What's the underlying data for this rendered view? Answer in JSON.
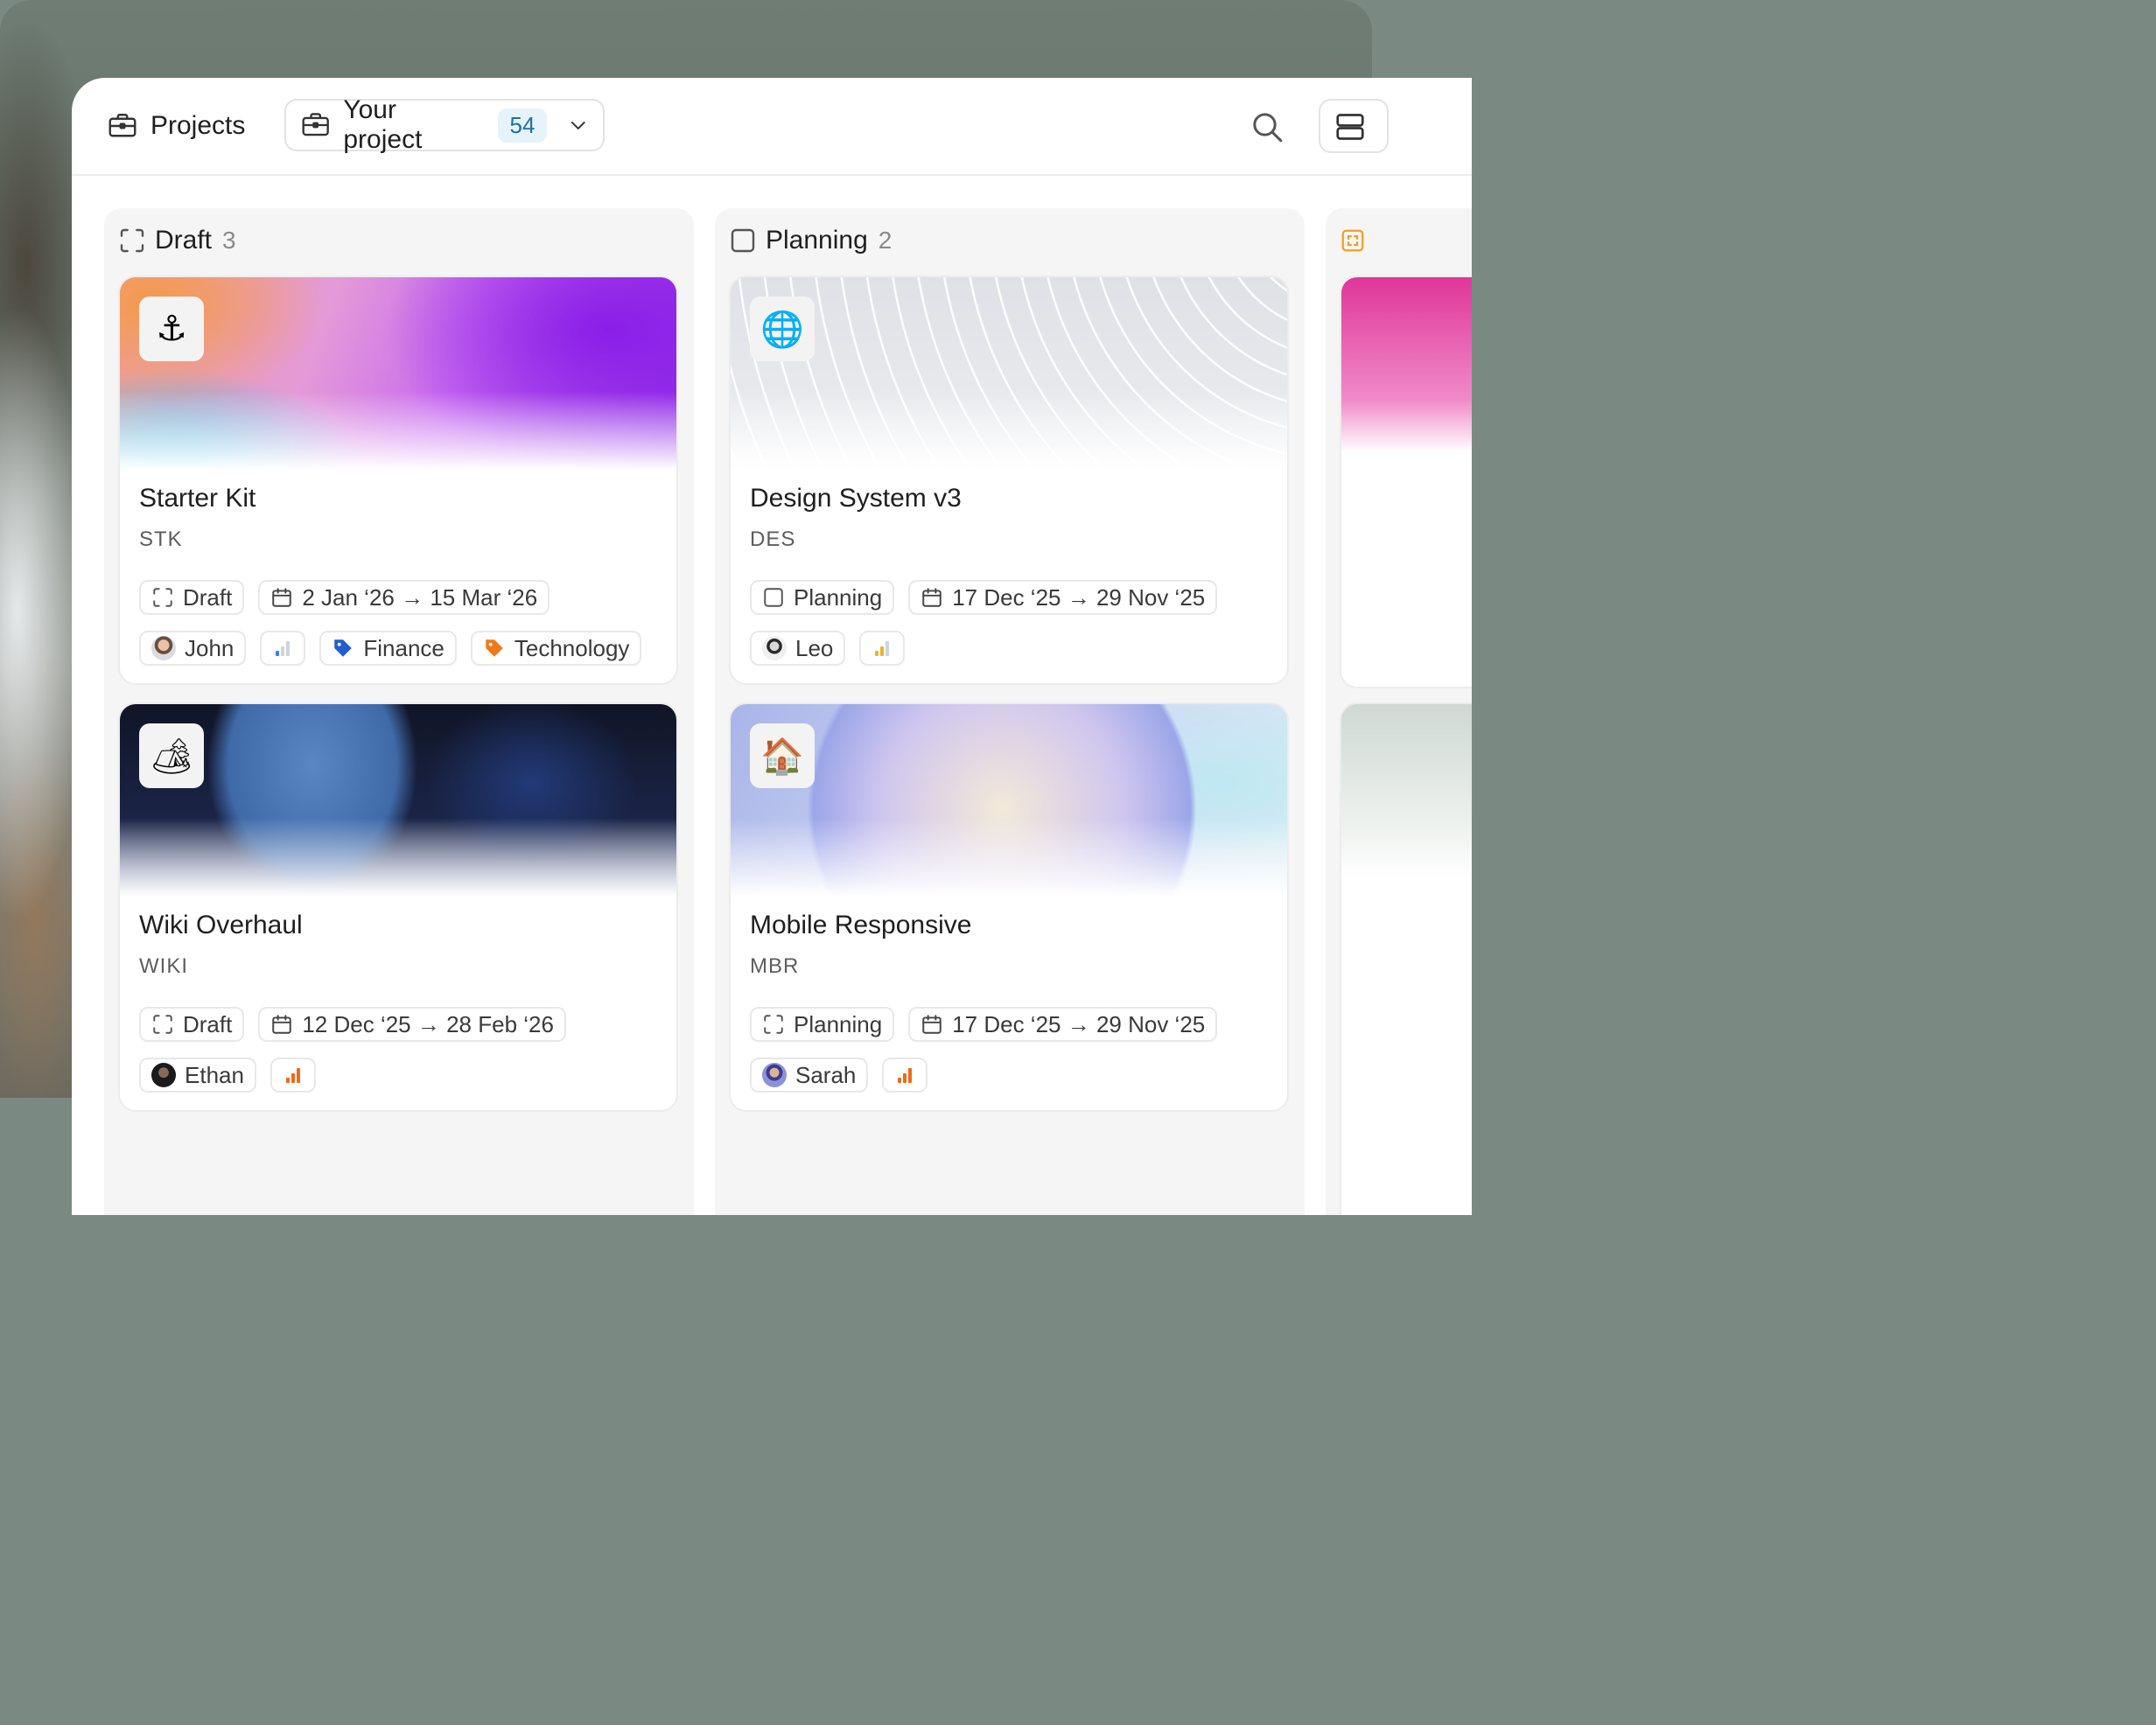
{
  "header": {
    "breadcrumb_label": "Projects",
    "project_selector": {
      "label": "Your project",
      "count": "54"
    }
  },
  "columns": [
    {
      "title": "Draft",
      "count": "3",
      "cards": [
        {
          "icon": "⚓",
          "title": "Starter Kit",
          "key": "STK",
          "status": "Draft",
          "dates": "2 Jan ‘26 → 15 Mar ‘26",
          "assignee": "John",
          "tags": [
            "Finance",
            "Technology"
          ]
        },
        {
          "icon": "🏕",
          "title": "Wiki Overhaul",
          "key": "WIKI",
          "status": "Draft",
          "dates": "12 Dec ‘25 → 28 Feb ‘26",
          "assignee": "Ethan",
          "tags": []
        }
      ]
    },
    {
      "title": "Planning",
      "count": "2",
      "cards": [
        {
          "icon": "🌐",
          "title": "Design System v3",
          "key": "DES",
          "status": "Planning",
          "dates": "17 Dec ‘25 → 29 Nov ‘25",
          "assignee": "Leo",
          "tags": []
        },
        {
          "icon": "🏠",
          "title": "Mobile Responsive",
          "key": "MBR",
          "status": "Planning",
          "dates": "17 Dec ‘25 → 29 Nov ‘25",
          "assignee": "Sarah",
          "tags": []
        }
      ]
    }
  ],
  "colors": {
    "badge_bg": "#e6f3fb",
    "badge_text": "#1d6fa5",
    "tag_finance": "#1f5fd1",
    "tag_technology": "#f07a18",
    "priority_low": "#3b82f6",
    "priority_medium": "#e9b62a",
    "priority_high": "#ef6a1a"
  }
}
